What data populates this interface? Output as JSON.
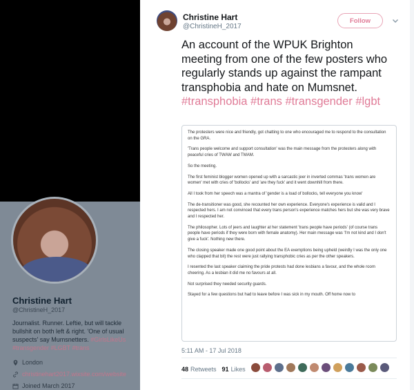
{
  "profile": {
    "name": "Christine Hart",
    "handle": "@ChristineH_2017",
    "bio_text": "Journalist. Runner. Leftie, but will tackle bullshit on both left & right. 'One of usual suspects' say Mumsnetters.",
    "bio_tags": [
      "#GirlsLikeUs",
      "#transgender",
      "#LGBT",
      "#trans"
    ],
    "location": "London",
    "website": "christinehart2017.wixsite.com/website",
    "joined": "Joined March 2017"
  },
  "tweet": {
    "author_name": "Christine Hart",
    "author_handle": "@ChristineH_2017",
    "follow_label": "Follow",
    "text": "An account of the WPUK Brighton meeting from one of the few posters who regularly stands up against the rampant transphobia and hate on Mumsnet.",
    "hashtags": [
      "#transphobia",
      "#trans",
      "#transgender",
      "#lgbt"
    ],
    "image_paragraphs": [
      "The protesters were nice and friendly, got chatting to one who encouraged me to respond to the consultation on the GRA.",
      "'Trans people welcome and support consultation' was the main message from the protesters along with peaceful cries of TWAW and TMAM.",
      "So the meeting.",
      "The first feminist blogger women opened up with a sarcastic jeer in inverted commas 'trans women are women' met with cries of 'bollocks' and 'are they fuck' and it went downhill from there.",
      "All I took from her speech was a mantra of 'gender is a load of bollocks, tell everyone you know'",
      "The de-transitioner was good, she recounted her own experience. Everyone's experience is valid and I respected hers. I am not convinced that every trans person's experience matches hers but she was very brave and I respected her.",
      "The philosopher. Lots of jeers and laughter at her statement 'trans people have periods' (of course trans people have periods if they were born with female anatomy). Her main message was 'I'm not kind and I don't give a fuck'. Nothing new there.",
      "The closing speaker made one good point about the EA exemptions being upheld (weirdly I was the only one who clapped that bit) the rest were just rallying transphobic cries as per the other speakers.",
      "I resented the last speaker claiming the pride protests had done lesbians a favour, and the whole room cheering. As a lesbian it did me no favours at all.",
      "Not surprised they needed security guards.",
      "Stayed for a few questions but had to leave before I was sick in my mouth. Off home now to"
    ],
    "timestamp": "5:11 AM - 17 Jul 2018",
    "retweets_count": "48",
    "retweets_label": "Retweets",
    "likes_count": "91",
    "likes_label": "Likes"
  },
  "colors": {
    "accent": "#e07b97",
    "liker_avatars": [
      "#8a4b3c",
      "#b85c6e",
      "#5d6f8c",
      "#a0785a",
      "#3e6b5a",
      "#c08a70",
      "#6b4e7a",
      "#d0a05c",
      "#4a7a9a",
      "#9a5a4a",
      "#7a8a5a",
      "#5a5a7a"
    ]
  }
}
